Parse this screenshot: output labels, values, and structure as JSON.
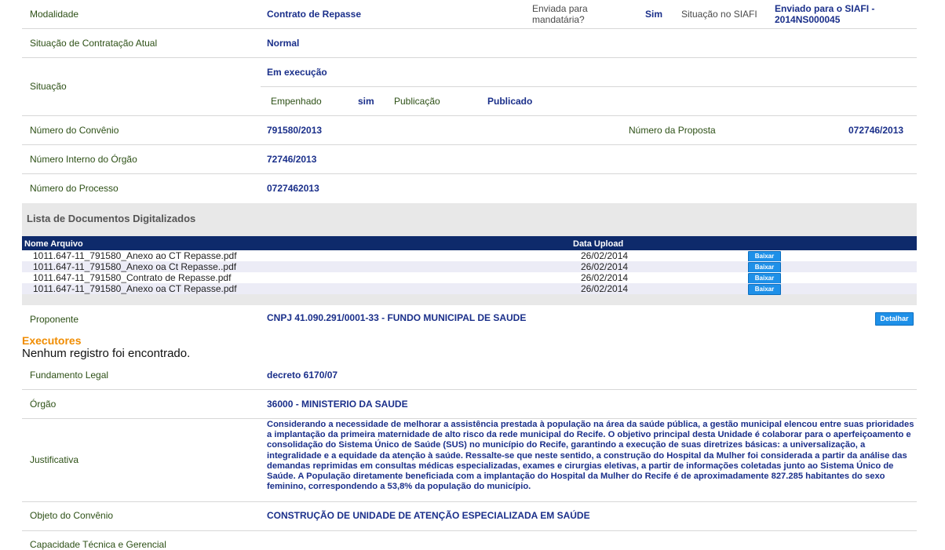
{
  "modalidade": {
    "label": "Modalidade",
    "value": "Contrato de Repasse",
    "mandataria_label": "Enviada para mandatária?",
    "mandataria_value": "Sim",
    "siafi_label": "Situação no SIAFI",
    "siafi_value": "Enviado para o SIAFI - 2014NS000045"
  },
  "contratacao": {
    "label": "Situação de Contratação Atual",
    "value": "Normal"
  },
  "situacao": {
    "label": "Situação",
    "value": "Em execução",
    "empenhado_label": "Empenhado",
    "empenhado_value": "sim",
    "publicacao_label": "Publicação",
    "publicacao_value": "Publicado"
  },
  "convenio": {
    "label": "Número do Convênio",
    "value": "791580/2013",
    "proposta_label": "Número da Proposta",
    "proposta_value": "072746/2013"
  },
  "interno": {
    "label": "Número Interno do Órgão",
    "value": "72746/2013"
  },
  "processo": {
    "label": "Número do Processo",
    "value": "0727462013"
  },
  "docs": {
    "title": "Lista de Documentos Digitalizados",
    "col_name": "Nome Arquivo",
    "col_date": "Data Upload",
    "button_label": "Baixar",
    "rows": [
      {
        "name": "1011.647-11_791580_Anexo ao CT Repasse.pdf",
        "date": "26/02/2014"
      },
      {
        "name": "1011.647-11_791580_Anexo oa Ct Repasse..pdf",
        "date": "26/02/2014"
      },
      {
        "name": "1011.647-11_791580_Contrato de Repasse.pdf",
        "date": "26/02/2014"
      },
      {
        "name": "1011.647-11_791580_Anexo oa CT Repasse.pdf",
        "date": "26/02/2014"
      }
    ]
  },
  "proponente": {
    "label": "Proponente",
    "value": "CNPJ 41.090.291/0001-33 - FUNDO MUNICIPAL DE SAUDE",
    "button_label": "Detalhar"
  },
  "executores": {
    "title": "Executores",
    "empty": "Nenhum registro foi encontrado."
  },
  "fundamento": {
    "label": "Fundamento Legal",
    "value": "decreto 6170/07"
  },
  "orgao": {
    "label": "Órgão",
    "value": "36000 - MINISTERIO DA SAUDE"
  },
  "justificativa": {
    "label": "Justificativa",
    "value": "Considerando a necessidade de melhorar a assistência prestada à população na área da saúde pública, a gestão municipal elencou entre suas prioridades a implantação da primeira maternidade de alto risco da rede municipal do Recife. O objetivo principal desta Unidade é colaborar para o aperfeiçoamento e consolidação do Sistema Único de Saúde (SUS) no município do Recife, garantindo a execução de suas diretrizes básicas: a universalização, a integralidade e a equidade da atenção à saúde. Ressalte-se que neste sentido, a construção do Hospital da Mulher foi considerada a partir da análise das demandas reprimidas em consultas médicas especializadas, exames e cirurgias eletivas, a partir de informações coletadas junto ao Sistema Único de Saúde. A População diretamente beneficiada com a implantação do Hospital da Mulher do Recife é de aproximadamente 827.285 habitantes do sexo feminino, correspondendo a 53,8% da população do município."
  },
  "objeto": {
    "label": "Objeto do Convênio",
    "value": "CONSTRUÇÃO DE UNIDADE DE ATENÇÃO ESPECIALIZADA EM SAÚDE"
  },
  "capacidade": {
    "label": "Capacidade Técnica e Gerencial"
  }
}
